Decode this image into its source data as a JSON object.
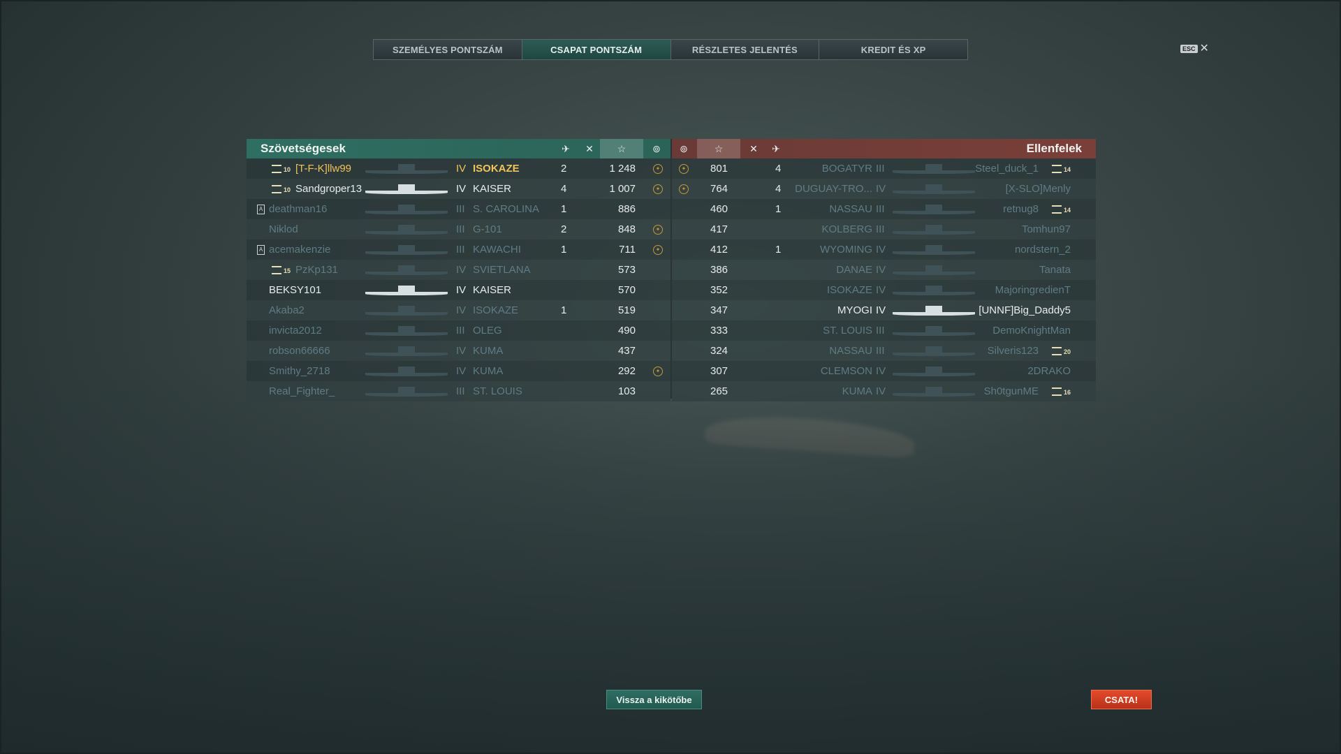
{
  "tabs": [
    "SZEMÉLYES PONTSZÁM",
    "CSAPAT PONTSZÁM",
    "RÉSZLETES JELENTÉS",
    "KREDIT ÉS XP"
  ],
  "active_tab": 1,
  "esc_label": "ESC",
  "allies": {
    "title": "Szövetségesek",
    "players": [
      {
        "rank": "10",
        "name": "[T-F-K]llw99",
        "tier": "IV",
        "ship": "ISOKAZE",
        "kills": "2",
        "xp": "1 248",
        "medal": true,
        "style": "gold"
      },
      {
        "rank": "10",
        "name": "Sandgroper13",
        "tier": "IV",
        "ship": "KAISER",
        "kills": "4",
        "xp": "1 007",
        "medal": true,
        "style": "bright"
      },
      {
        "clan": true,
        "name": "deathman16",
        "tier": "III",
        "ship": "S. CAROLINA",
        "kills": "1",
        "xp": "886",
        "medal": false,
        "style": "dim"
      },
      {
        "name": "Niklod",
        "tier": "III",
        "ship": "G-101",
        "kills": "2",
        "xp": "848",
        "medal": true,
        "style": "dim"
      },
      {
        "clan": true,
        "name": "acemakenzie",
        "tier": "III",
        "ship": "KAWACHI",
        "kills": "1",
        "xp": "711",
        "medal": true,
        "style": "dim"
      },
      {
        "rank": "15",
        "name": "PzKp131",
        "tier": "IV",
        "ship": "SVIETLANA",
        "kills": "",
        "xp": "573",
        "medal": false,
        "style": "dim"
      },
      {
        "name": "BEKSY101",
        "tier": "IV",
        "ship": "KAISER",
        "kills": "",
        "xp": "570",
        "medal": false,
        "style": "bright"
      },
      {
        "name": "Akaba2",
        "tier": "IV",
        "ship": "ISOKAZE",
        "kills": "1",
        "xp": "519",
        "medal": false,
        "style": "dim"
      },
      {
        "name": "invicta2012",
        "tier": "III",
        "ship": "OLEG",
        "kills": "",
        "xp": "490",
        "medal": false,
        "style": "dim"
      },
      {
        "name": "robson66666",
        "tier": "IV",
        "ship": "KUMA",
        "kills": "",
        "xp": "437",
        "medal": false,
        "style": "dim"
      },
      {
        "name": "Smithy_2718",
        "tier": "IV",
        "ship": "KUMA",
        "kills": "",
        "xp": "292",
        "medal": true,
        "style": "dim"
      },
      {
        "name": "Real_Fighter_",
        "tier": "III",
        "ship": "ST. LOUIS",
        "kills": "",
        "xp": "103",
        "medal": false,
        "style": "dim"
      }
    ]
  },
  "enemies": {
    "title": "Ellenfelek",
    "players": [
      {
        "name": "Steel_duck_1",
        "rank": "14",
        "tier": "III",
        "ship": "BOGATYR",
        "kills": "4",
        "xp": "801",
        "medal": true,
        "style": "dim"
      },
      {
        "name": "[X-SLO]Menly",
        "tier": "IV",
        "ship": "DUGUAY-TRO...",
        "kills": "4",
        "xp": "764",
        "medal": true,
        "style": "dim"
      },
      {
        "name": "retnug8",
        "rank": "14",
        "tier": "III",
        "ship": "NASSAU",
        "kills": "1",
        "xp": "460",
        "medal": false,
        "style": "dim"
      },
      {
        "name": "Tomhun97",
        "tier": "III",
        "ship": "KOLBERG",
        "kills": "",
        "xp": "417",
        "medal": false,
        "style": "dim"
      },
      {
        "name": "nordstern_2",
        "tier": "IV",
        "ship": "WYOMING",
        "kills": "1",
        "xp": "412",
        "medal": false,
        "style": "dim"
      },
      {
        "name": "Tanata",
        "tier": "IV",
        "ship": "DANAE",
        "kills": "",
        "xp": "386",
        "medal": false,
        "style": "dim"
      },
      {
        "name": "MajoringredienT",
        "tier": "IV",
        "ship": "ISOKAZE",
        "kills": "",
        "xp": "352",
        "medal": false,
        "style": "dim"
      },
      {
        "name": "[UNNF]Big_Daddy5",
        "tier": "IV",
        "ship": "MYOGI",
        "kills": "",
        "xp": "347",
        "medal": false,
        "style": "bright"
      },
      {
        "name": "DemoKnightMan",
        "tier": "III",
        "ship": "ST. LOUIS",
        "kills": "",
        "xp": "333",
        "medal": false,
        "style": "dim"
      },
      {
        "name": "Silveris123",
        "rank": "20",
        "tier": "III",
        "ship": "NASSAU",
        "kills": "",
        "xp": "324",
        "medal": false,
        "style": "dim"
      },
      {
        "name": "2DRAKO",
        "tier": "IV",
        "ship": "CLEMSON",
        "kills": "",
        "xp": "307",
        "medal": false,
        "style": "dim"
      },
      {
        "name": "Sh0tgunME",
        "rank": "16",
        "tier": "IV",
        "ship": "KUMA",
        "kills": "",
        "xp": "265",
        "medal": false,
        "style": "dim"
      }
    ]
  },
  "buttons": {
    "port": "Vissza a kikötőbe",
    "battle": "CSATA!"
  },
  "colors": {
    "allies": "#2f6e62",
    "enemies": "#7a3f38",
    "battle": "#d63e22",
    "gold_text": "#f0c45a"
  }
}
